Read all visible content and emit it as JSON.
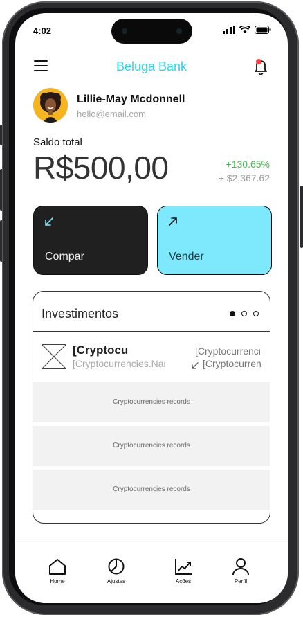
{
  "status": {
    "time": "4:02"
  },
  "app": {
    "title": "Beluga Bank"
  },
  "user": {
    "name": "Lillie-May Mcdonnell",
    "email": "hello@email.com"
  },
  "balance": {
    "label": "Saldo total",
    "value": "R$500,00",
    "change_percent": "+130.65%",
    "change_amount": "+ $2,367.62"
  },
  "actions": {
    "buy_label": "Compar",
    "sell_label": "Vender"
  },
  "investments": {
    "title": "Investimentos",
    "pages": 3,
    "active_page": 1,
    "row": {
      "name": "[Cryptocurrencies.Name]",
      "subtitle": "[Cryptocurrencies.Name]",
      "price": "[Cryptocurrencies.Price]",
      "change": "[Cryptocurrencies.Change]"
    },
    "records": [
      "Cryptocurrencies records",
      "Cryptocurrencies records",
      "Cryptocurrencies records"
    ]
  },
  "tabbar": {
    "items": [
      {
        "label": "Home",
        "icon": "home-icon"
      },
      {
        "label": "Ajustes",
        "icon": "pie-chart-icon"
      },
      {
        "label": "Ações",
        "icon": "trending-up-icon"
      },
      {
        "label": "Perfil",
        "icon": "user-icon"
      }
    ]
  },
  "colors": {
    "accent": "#2ad6ec",
    "sell_button": "#7ee8fd",
    "buy_button": "#202020",
    "positive": "#3fbf4c",
    "notification": "#ff3b3b"
  }
}
